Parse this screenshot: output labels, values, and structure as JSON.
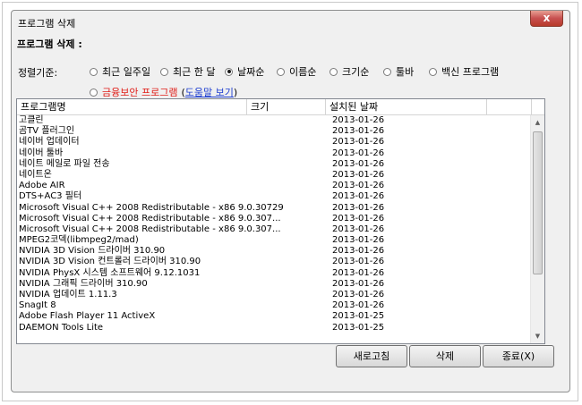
{
  "window": {
    "title": "프로그램 삭제",
    "close_label": "x"
  },
  "section_title": "프로그램 삭제 :",
  "sort": {
    "label": "정렬기준:",
    "options": [
      {
        "label": "최근 일주일",
        "checked": false
      },
      {
        "label": "최근 한 달",
        "checked": false
      },
      {
        "label": "날짜순",
        "checked": true
      },
      {
        "label": "이름순",
        "checked": false
      },
      {
        "label": "크기순",
        "checked": false
      },
      {
        "label": "툴바",
        "checked": false
      },
      {
        "label": "백신 프로그램",
        "checked": false
      }
    ],
    "finance_option": {
      "label": "금융보안 프로그램",
      "checked": false
    },
    "help_open": "(",
    "help_link": "도움말 보기",
    "help_close": ")"
  },
  "list": {
    "columns": [
      "프로그램명",
      "크기",
      "설치된 날짜"
    ],
    "rows": [
      {
        "name": "고클린",
        "date": "2013-01-26"
      },
      {
        "name": "곰TV 플러그인",
        "date": "2013-01-26"
      },
      {
        "name": "네이버 업데이터",
        "date": "2013-01-26"
      },
      {
        "name": "네이버 툴바",
        "date": "2013-01-26"
      },
      {
        "name": "네이트 메일로 파일 전송",
        "date": "2013-01-26"
      },
      {
        "name": "네이트온",
        "date": "2013-01-26"
      },
      {
        "name": "Adobe AIR",
        "date": "2013-01-26"
      },
      {
        "name": "DTS+AC3 필터",
        "date": "2013-01-26"
      },
      {
        "name": "Microsoft Visual C++ 2008 Redistributable - x86 9.0.30729",
        "date": "2013-01-26"
      },
      {
        "name": "Microsoft Visual C++ 2008 Redistributable - x86 9.0.307...",
        "date": "2013-01-26"
      },
      {
        "name": "Microsoft Visual C++ 2008 Redistributable - x86 9.0.307...",
        "date": "2013-01-26"
      },
      {
        "name": "MPEG2코덱(libmpeg2/mad)",
        "date": "2013-01-26"
      },
      {
        "name": "NVIDIA 3D Vision 드라이버 310.90",
        "date": "2013-01-26"
      },
      {
        "name": "NVIDIA 3D Vision 컨트롤러 드라이버 310.90",
        "date": "2013-01-26"
      },
      {
        "name": "NVIDIA PhysX 시스템 소프트웨어 9.12.1031",
        "date": "2013-01-26"
      },
      {
        "name": "NVIDIA 그래픽 드라이버 310.90",
        "date": "2013-01-26"
      },
      {
        "name": "NVIDIA 업데이트 1.11.3",
        "date": "2013-01-26"
      },
      {
        "name": "SnagIt 8",
        "date": "2013-01-26"
      },
      {
        "name": "Adobe Flash Player 11 ActiveX",
        "date": "2013-01-25"
      },
      {
        "name": "DAEMON Tools Lite",
        "date": "2013-01-25"
      }
    ]
  },
  "buttons": {
    "refresh": "새로고침",
    "delete": "삭제",
    "exit": "종료(X)"
  }
}
